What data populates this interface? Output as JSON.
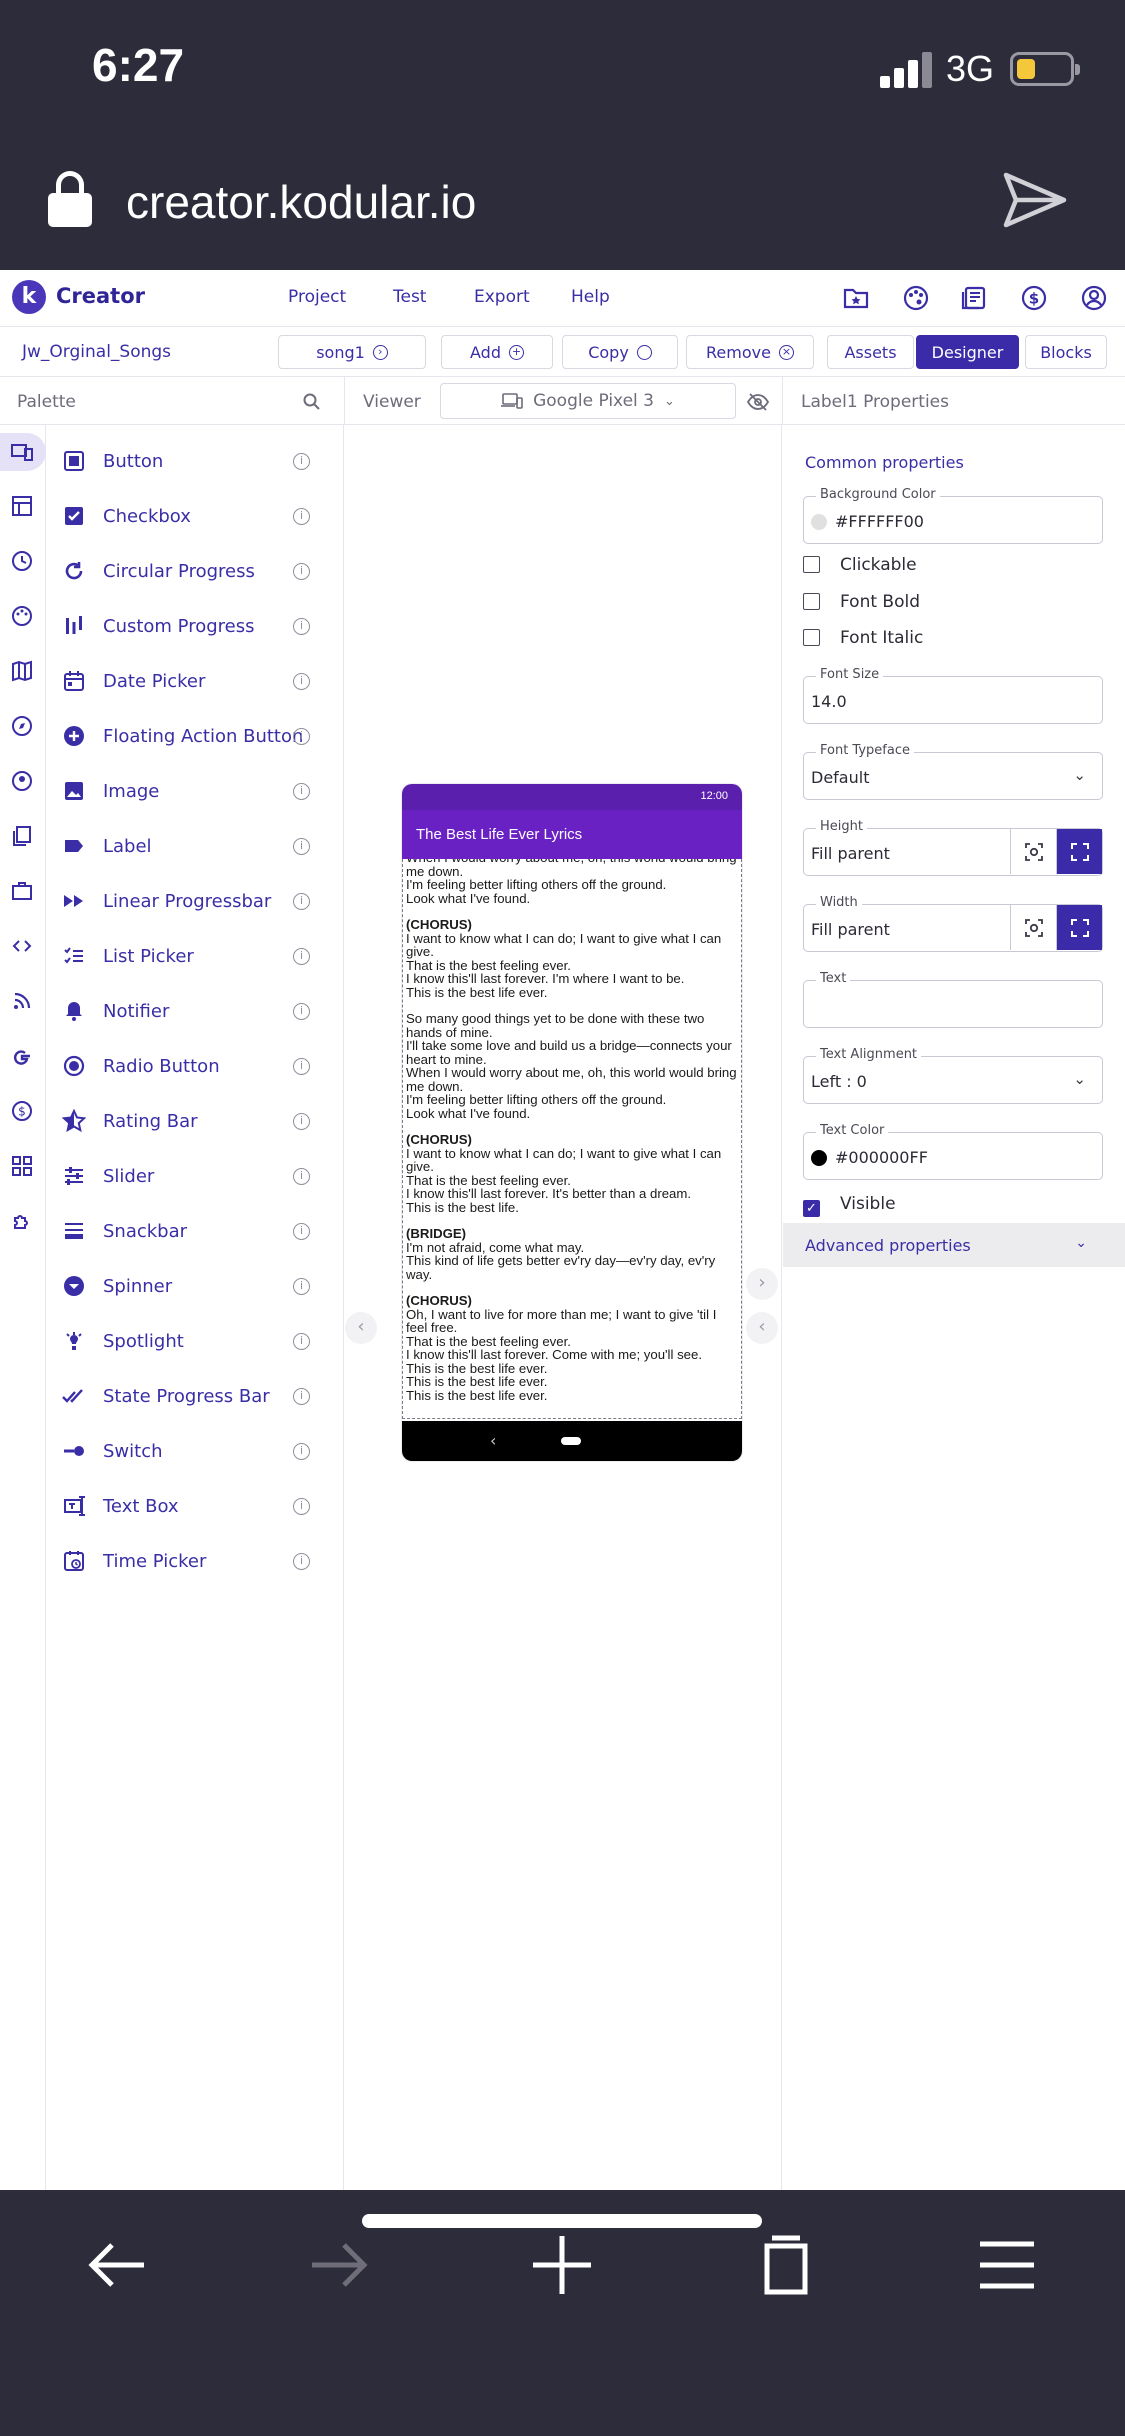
{
  "status_bar": {
    "time": "6:27",
    "network": "3G",
    "battery_level": 0.35,
    "battery_color": "#f5c83b"
  },
  "url_bar": {
    "url": "creator.kodular.io"
  },
  "app": {
    "name": "Creator",
    "logo_letter": "k",
    "accent_color": "#3b2ba8",
    "menu": [
      "Project",
      "Test",
      "Export",
      "Help"
    ],
    "top_icons": [
      "folder-star-icon",
      "palette-icon",
      "news-icon",
      "dollar-icon",
      "account-icon"
    ]
  },
  "toolbar": {
    "project_name": "Jw_Orginal_Songs",
    "screen_select": "song1",
    "add_label": "Add",
    "copy_label": "Copy",
    "remove_label": "Remove",
    "assets_label": "Assets",
    "designer_label": "Designer",
    "blocks_label": "Blocks"
  },
  "palette": {
    "title": "Palette",
    "items": [
      {
        "label": "Button",
        "icon": "button-icon"
      },
      {
        "label": "Checkbox",
        "icon": "checkbox-icon"
      },
      {
        "label": "Circular Progress",
        "icon": "circular-progress-icon"
      },
      {
        "label": "Custom Progress",
        "icon": "custom-progress-icon"
      },
      {
        "label": "Date Picker",
        "icon": "calendar-icon"
      },
      {
        "label": "Floating Action Button",
        "icon": "fab-plus-icon"
      },
      {
        "label": "Image",
        "icon": "image-icon"
      },
      {
        "label": "Label",
        "icon": "label-tag-icon"
      },
      {
        "label": "Linear Progressbar",
        "icon": "fast-forward-icon"
      },
      {
        "label": "List Picker",
        "icon": "list-picker-icon"
      },
      {
        "label": "Notifier",
        "icon": "bell-icon"
      },
      {
        "label": "Radio Button",
        "icon": "radio-button-icon"
      },
      {
        "label": "Rating Bar",
        "icon": "star-icon"
      },
      {
        "label": "Slider",
        "icon": "slider-icon"
      },
      {
        "label": "Snackbar",
        "icon": "snackbar-icon"
      },
      {
        "label": "Spinner",
        "icon": "spinner-dropdown-icon"
      },
      {
        "label": "Spotlight",
        "icon": "spotlight-icon"
      },
      {
        "label": "State Progress Bar",
        "icon": "double-check-icon"
      },
      {
        "label": "Switch",
        "icon": "switch-icon"
      },
      {
        "label": "Text Box",
        "icon": "text-box-icon"
      },
      {
        "label": "Time Picker",
        "icon": "time-picker-icon"
      }
    ],
    "info_glyph": "i"
  },
  "viewer": {
    "title": "Viewer",
    "device": "Google Pixel 3",
    "phone_time": "12:00",
    "app_title": "The Best Life Ever Lyrics",
    "lyrics": [
      {
        "heading": "",
        "lines": "When I would worry about me, oh, this world would bring me down.\nI'm feeling better lifting others off the ground.\nLook what I've found."
      },
      {
        "heading": "(CHORUS)",
        "lines": "I want to know what I can do; I want to give what I can give.\nThat is the best feeling ever.\nI know this'll last forever. I'm where I want to be.\nThis is the best life ever."
      },
      {
        "heading": "",
        "lines": "So many good things yet to be done with these two hands of mine.\nI'll take some love and build us a bridge—connects your heart to mine.\nWhen I would worry about me, oh, this world would bring me down.\nI'm feeling better lifting others off the ground.\nLook what I've found."
      },
      {
        "heading": "(CHORUS)",
        "lines": "I want to know what I can do; I want to give what I can give.\nThat is the best feeling ever.\nI know this'll last forever. It's better than a dream.\nThis is the best life."
      },
      {
        "heading": "(BRIDGE)",
        "lines": "I'm not afraid, come what may.\nThis kind of life gets better ev'ry day—ev'ry day, ev'ry way."
      },
      {
        "heading": "(CHORUS)",
        "lines": "Oh, I want to live for more than me; I want to give 'til I feel free.\nThat is the best feeling ever.\nI know this'll last forever. Come with me; you'll see.\nThis is the best life ever.\nThis is the best life ever.\nThis is the best life ever."
      }
    ]
  },
  "properties": {
    "title": "Label1 Properties",
    "common_label": "Common properties",
    "background_color": {
      "label": "Background Color",
      "value": "#FFFFFF00",
      "swatch": "#e0e0e0"
    },
    "clickable_label": "Clickable",
    "font_bold_label": "Font Bold",
    "font_italic_label": "Font Italic",
    "font_size": {
      "label": "Font Size",
      "value": "14.0"
    },
    "font_typeface": {
      "label": "Font Typeface",
      "value": "Default"
    },
    "height": {
      "label": "Height",
      "value": "Fill parent"
    },
    "width": {
      "label": "Width",
      "value": "Fill parent"
    },
    "text": {
      "label": "Text",
      "value": ""
    },
    "text_alignment": {
      "label": "Text Alignment",
      "value": "Left : 0"
    },
    "text_color": {
      "label": "Text Color",
      "value": "#000000FF",
      "swatch": "#000000"
    },
    "visible_label": "Visible",
    "advanced_label": "Advanced properties"
  }
}
